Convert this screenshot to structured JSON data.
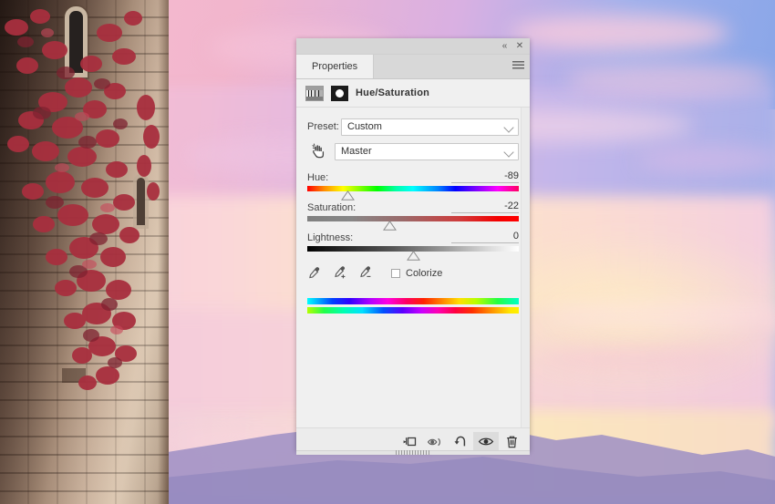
{
  "photo": {
    "description": "stone-tower-with-red-ivy-at-sunset",
    "sky_colors": [
      "#f3b9cf",
      "#d4b4e6",
      "#8aa5e7",
      "#ffe6b0"
    ],
    "tower_colors": [
      "#4b3c36",
      "#d8c3ad"
    ],
    "ivy_color": "#a8303f",
    "mountain_color": "#9d8fc4"
  },
  "panel": {
    "window_controls": {
      "collapse_icon": "double-chevron-left-icon",
      "collapse_glyph": "«",
      "close_icon": "close-icon",
      "close_glyph": "✕"
    },
    "menu_icon": "panel-menu-icon",
    "tabs": [
      {
        "label": "Properties",
        "active": true
      }
    ],
    "adjustment": {
      "layer_thumbnail_icon": "adjustment-layer-thumbnail-icon",
      "mask_thumbnail_icon": "layer-mask-thumbnail-icon",
      "title": "Hue/Saturation"
    },
    "preset": {
      "label": "Preset:",
      "value": "Custom",
      "chevron_icon": "chevron-down-icon"
    },
    "channel": {
      "on_image_tool_icon": "on-image-adjustment-hand-icon",
      "value": "Master",
      "chevron_icon": "chevron-down-icon"
    },
    "sliders": [
      {
        "id": "hue",
        "label": "Hue:",
        "value": "-89",
        "min": -180,
        "max": 180,
        "thumb_percent": 19.3
      },
      {
        "id": "saturation",
        "label": "Saturation:",
        "value": "-22",
        "min": -100,
        "max": 100,
        "thumb_percent": 39.0
      },
      {
        "id": "lightness",
        "label": "Lightness:",
        "value": "0",
        "min": -100,
        "max": 100,
        "thumb_percent": 50.0
      }
    ],
    "eyedroppers": [
      {
        "name": "eyedropper-sample-icon",
        "modifier": ""
      },
      {
        "name": "eyedropper-add-to-sample-icon",
        "modifier": "+"
      },
      {
        "name": "eyedropper-subtract-from-sample-icon",
        "modifier": "−"
      }
    ],
    "colorize": {
      "label": "Colorize",
      "checked": false
    },
    "spectrum_bars": {
      "top_name": "source-hue-spectrum-bar",
      "bottom_name": "result-hue-spectrum-bar"
    },
    "scrollbar_name": "panel-vertical-scrollbar",
    "footer_buttons": [
      {
        "name": "clip-to-layer-button",
        "icon": "clip-to-layer-icon",
        "active": false
      },
      {
        "name": "view-previous-state-button",
        "icon": "eye-previous-state-icon",
        "active": false
      },
      {
        "name": "reset-adjustment-button",
        "icon": "reset-arrow-icon",
        "active": false
      },
      {
        "name": "toggle-layer-visibility-button",
        "icon": "eye-icon",
        "active": true
      },
      {
        "name": "delete-adjustment-layer-button",
        "icon": "trash-icon",
        "active": false
      }
    ],
    "resize_grip_name": "panel-resize-grip"
  }
}
